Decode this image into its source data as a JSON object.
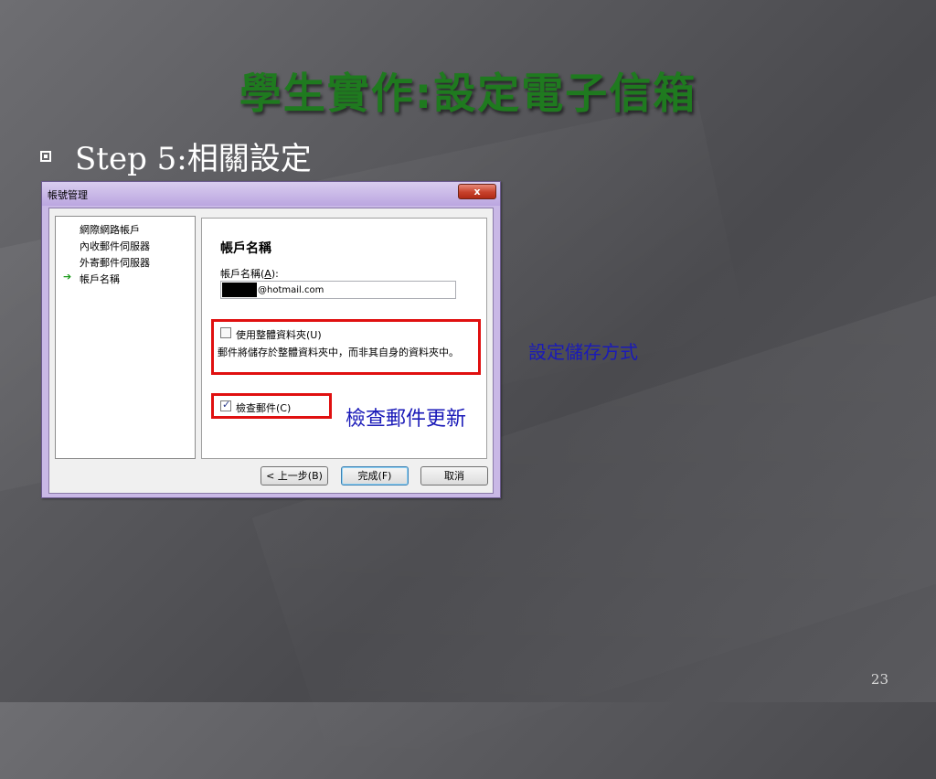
{
  "slide": {
    "title": "學生實作:設定電子信箱",
    "step": "Step 5:相關設定",
    "page_number": "23"
  },
  "dialog": {
    "title": "帳號管理",
    "close_label": "x",
    "nav_items": [
      {
        "label": "網際網路帳戶",
        "active": false
      },
      {
        "label": "內收郵件伺服器",
        "active": false
      },
      {
        "label": "外寄郵件伺服器",
        "active": false
      },
      {
        "label": "帳戶名稱",
        "active": true
      }
    ],
    "active_arrow": "➔",
    "heading": "帳戶名稱",
    "account_name_label": "帳戶名稱",
    "account_name_accesskey": "A",
    "account_name_value": "@hotmail.com",
    "use_folder_label": "使用整體資料夾(U)",
    "use_folder_checked": false,
    "use_folder_description": "郵件將儲存於整體資料夾中，而非其自身的資料夾中。",
    "check_mail_label": "檢查郵件(C)",
    "check_mail_checked": true,
    "buttons": {
      "back": "< 上一步(B)",
      "finish": "完成(F)",
      "cancel": "取消"
    }
  },
  "annotations": {
    "storage": "設定儲存方式",
    "check_mail": "檢查郵件更新"
  },
  "colors": {
    "title": "#1f7a1f",
    "highlight": "#e01010",
    "annotation": "#1a1ab8"
  }
}
